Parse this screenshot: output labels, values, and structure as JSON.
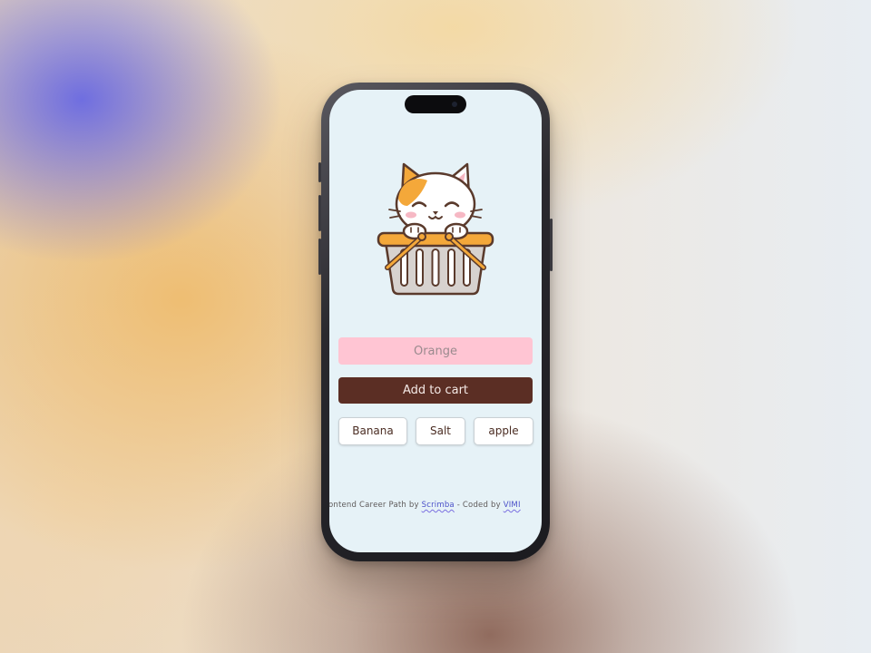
{
  "app": {
    "input": {
      "value": "",
      "placeholder": "Orange"
    },
    "add_button_label": "Add to cart",
    "items": [
      {
        "label": "Banana"
      },
      {
        "label": "Salt"
      },
      {
        "label": "apple"
      }
    ],
    "footer": {
      "prefix": "Frontend Career Path by ",
      "link1": "Scrimba",
      "middle": " - Coded by ",
      "link2": "VIMI"
    }
  },
  "icons": {
    "hero": "cat-in-basket-icon"
  },
  "colors": {
    "screen_bg": "#e6f2f7",
    "input_bg": "#ffc5d3",
    "button_bg": "#5b2e24",
    "button_text": "#f4e9e6",
    "item_text": "#4a2c22",
    "link": "#4a4fc8"
  }
}
